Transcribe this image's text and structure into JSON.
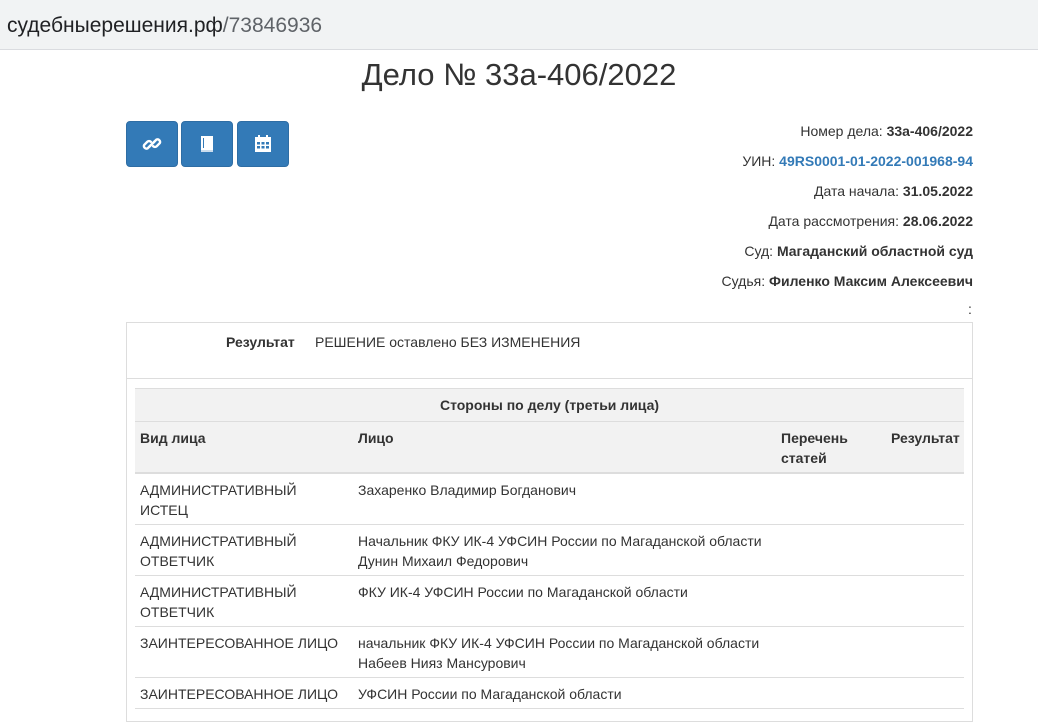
{
  "browser": {
    "url_host": "судебныерешения.рф",
    "url_path": "/73846936"
  },
  "page": {
    "title": "Дело № 33а-406/2022"
  },
  "toolbar": {
    "buttons": [
      "link-icon",
      "book-icon",
      "calendar-icon"
    ],
    "accent": "#337ab7"
  },
  "case_info": {
    "number_label": "Номер дела:",
    "number_value": "33а-406/2022",
    "uin_label": "УИН:",
    "uin_value": "49RS0001-01-2022-001968-94",
    "start_label": "Дата начала:",
    "start_value": "31.05.2022",
    "review_label": "Дата рассмотрения:",
    "review_value": "28.06.2022",
    "court_label": "Суд:",
    "court_value": "Магаданский областной суд",
    "judge_label": "Судья:",
    "judge_value": "Филенко Максим Алексеевич",
    "trailing_mark": ":"
  },
  "result": {
    "label": "Результат",
    "value": "РЕШЕНИЕ оставлено БЕЗ ИЗМЕНЕНИЯ"
  },
  "parties": {
    "caption": "Стороны по делу (третьи лица)",
    "columns": [
      "Вид лица",
      "Лицо",
      "Перечень статей",
      "Результат"
    ],
    "rows": [
      {
        "type": "АДМИНИСТРАТИВНЫЙ ИСТЕЦ",
        "person": "Захаренко Владимир Богданович",
        "articles": "",
        "result": ""
      },
      {
        "type": "АДМИНИСТРАТИВНЫЙ ОТВЕТЧИК",
        "person": "Начальник ФКУ ИК-4 УФСИН России по Магаданской области Дунин Михаил Федорович",
        "articles": "",
        "result": ""
      },
      {
        "type": "АДМИНИСТРАТИВНЫЙ ОТВЕТЧИК",
        "person": "ФКУ ИК-4 УФСИН России по Магаданской области",
        "articles": "",
        "result": ""
      },
      {
        "type": "ЗАИНТЕРЕСОВАННОЕ ЛИЦО",
        "person": "начальник ФКУ ИК-4 УФСИН России по Магаданской области Набеев Нияз Мансурович",
        "articles": "",
        "result": ""
      },
      {
        "type": "ЗАИНТЕРЕСОВАННОЕ ЛИЦО",
        "person": "УФСИН России по Магаданской области",
        "articles": "",
        "result": ""
      }
    ]
  }
}
